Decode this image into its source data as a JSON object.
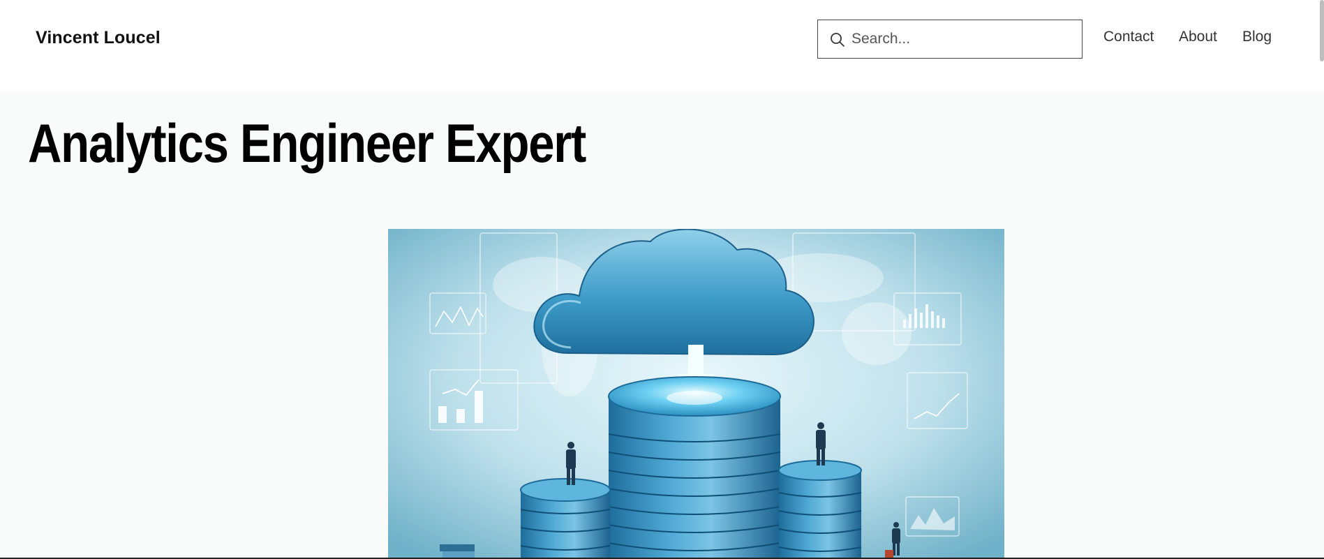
{
  "header": {
    "brand": "Vincent Loucel",
    "search": {
      "placeholder": "Search...",
      "value": "",
      "icon": "search-icon"
    },
    "nav": [
      {
        "label": "Contact"
      },
      {
        "label": "About"
      },
      {
        "label": "Blog"
      }
    ]
  },
  "main": {
    "title": "Analytics Engineer Expert",
    "hero_image": {
      "subject": "cloud-database-illustration"
    }
  },
  "colors": {
    "page_background": "#f9fafa",
    "header_background": "#ffffff",
    "hero_blue": "#3f9fc8",
    "hero_background": "#bfe1ec"
  }
}
